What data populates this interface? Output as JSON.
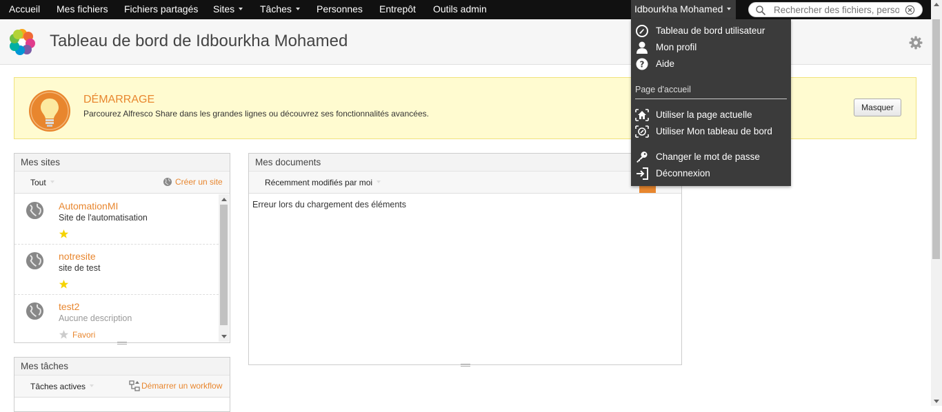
{
  "topbar": {
    "nav": [
      "Accueil",
      "Mes fichiers",
      "Fichiers partagés",
      "Sites",
      "Tâches",
      "Personnes",
      "Entrepôt",
      "Outils admin"
    ],
    "user_name": "Idbourkha Mohamed",
    "search_placeholder": "Rechercher des fichiers, personnes, sites"
  },
  "header": {
    "title": "Tableau de bord de Idbourkha Mohamed"
  },
  "banner": {
    "title": "DÉMARRAGE",
    "text": "Parcourez Alfresco Share dans les grandes lignes ou découvrez ses fonctionnalités avancées.",
    "hide_button": "Masquer"
  },
  "my_sites": {
    "title": "Mes sites",
    "filter": "Tout",
    "create_link": "Créer un site",
    "sites": [
      {
        "name": "AutomationMI",
        "description": "Site de l'automatisation"
      },
      {
        "name": "notresite",
        "description": "site de test"
      },
      {
        "name": "test2",
        "description": "Aucune description"
      }
    ],
    "favorite_label": "Favori"
  },
  "my_tasks": {
    "title": "Mes tâches",
    "filter": "Tâches actives",
    "start_workflow": "Démarrer un workflow"
  },
  "my_documents": {
    "title": "Mes documents",
    "filter": "Récemment modifiés par moi",
    "error": "Erreur lors du chargement des éléments"
  },
  "user_dropdown": {
    "items": [
      "Tableau de bord utilisateur",
      "Mon profil",
      "Aide"
    ],
    "home_heading": "Page d'accueil",
    "home_items": [
      "Utiliser la page actuelle",
      "Utiliser Mon tableau de bord"
    ],
    "account_items": [
      "Changer le mot de passe",
      "Déconnexion"
    ]
  },
  "colors": {
    "accent": "#e8862e",
    "topbar": "#111111",
    "menu": "#3b3b3b",
    "banner_bg": "#fffbd0"
  }
}
